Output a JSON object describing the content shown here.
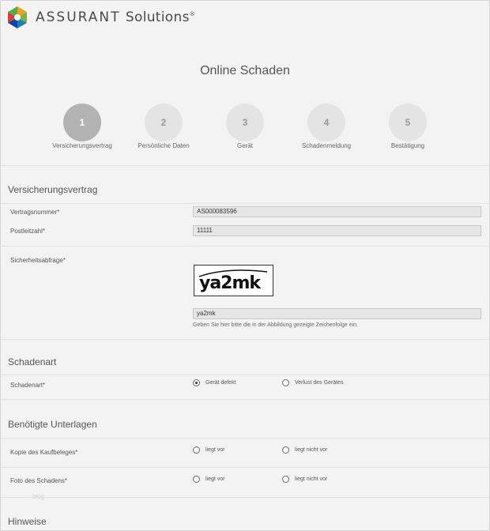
{
  "header": {
    "brand": "ASSURANT",
    "product": "Solutions",
    "trademark": "®",
    "logo_colors": [
      "#f3a11b",
      "#4caf50",
      "#1c7fc1",
      "#e53935",
      "#7cb342",
      "#0d47a1"
    ]
  },
  "page_title": "Online Schaden",
  "steps": [
    {
      "number": "1",
      "label": "Versicherungsvertrag",
      "active": true
    },
    {
      "number": "2",
      "label": "Persönliche Daten",
      "active": false
    },
    {
      "number": "3",
      "label": "Gerät",
      "active": false
    },
    {
      "number": "4",
      "label": "Schadenmeldung",
      "active": false
    },
    {
      "number": "5",
      "label": "Bestätigung",
      "active": false
    }
  ],
  "contract_section": {
    "title": "Versicherungsvertrag",
    "contract_number_label": "Vertragsnummer*",
    "contract_number_value": "AS000083596",
    "postal_code_label": "Postleitzahl*",
    "postal_code_value": "11111",
    "security_label": "Sicherheitsabfrage*",
    "captcha_text": "ya2mk",
    "captcha_input_value": "ya2mk",
    "captcha_help": "Geben Sie hier bitte die in der Abbildung gezeigte Zeichenfolge ein."
  },
  "damage_type_section": {
    "title": "Schadenart",
    "label": "Schadenart*",
    "options": [
      {
        "label": "Gerät defekt",
        "selected": true
      },
      {
        "label": "Verlust des Gerätes",
        "selected": false
      }
    ]
  },
  "documents_section": {
    "title": "Benötigte Unterlagen",
    "rows": [
      {
        "label": "Kopie des Kaufbeleges*",
        "option_yes": "liegt vor",
        "option_no": "liegt nicht vor"
      },
      {
        "label": "Foto des Schadens*",
        "option_yes": "liegt vor",
        "option_no": "liegt nicht vor"
      }
    ]
  },
  "watermark": "blog",
  "notes_section": {
    "title": "Hinweise"
  }
}
